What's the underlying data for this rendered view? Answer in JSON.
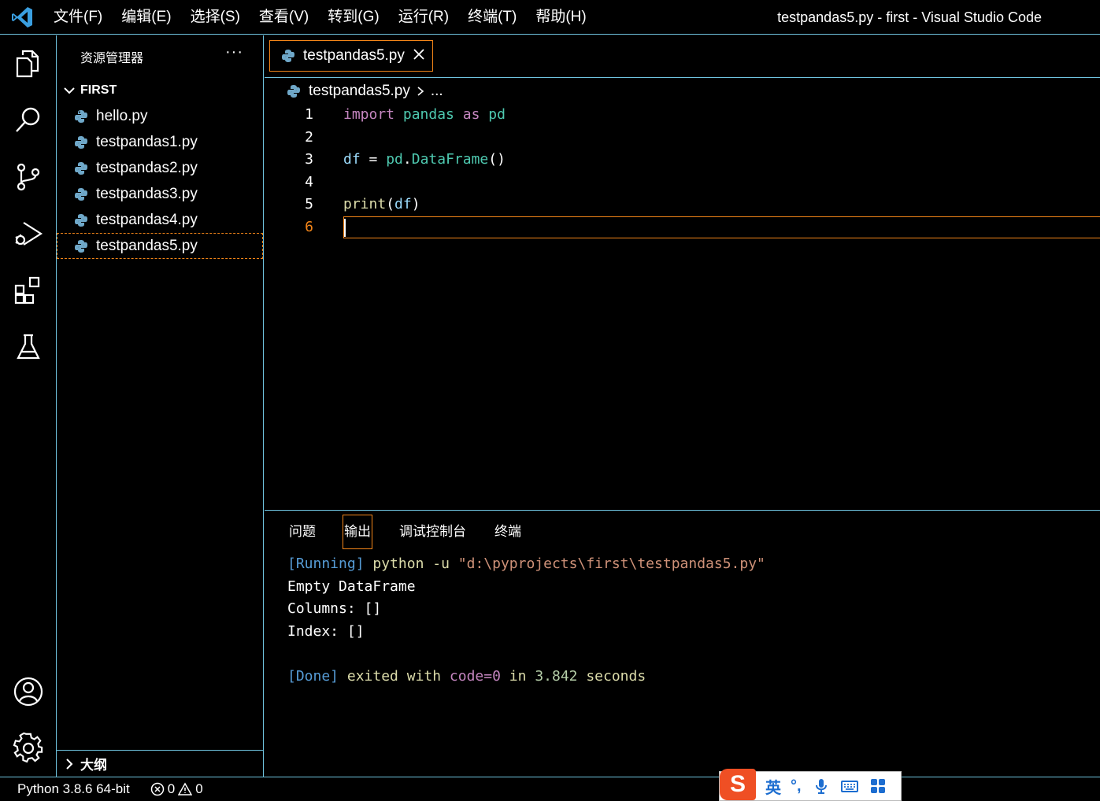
{
  "titlebar": {
    "menu": [
      "文件(F)",
      "编辑(E)",
      "选择(S)",
      "查看(V)",
      "转到(G)",
      "运行(R)",
      "终端(T)",
      "帮助(H)"
    ],
    "window_title": "testpandas5.py - first - Visual Studio Code"
  },
  "activity_bar": {
    "items": [
      "explorer-icon",
      "search-icon",
      "source-control-icon",
      "run-debug-icon",
      "extensions-icon",
      "testing-icon"
    ],
    "bottom": [
      "account-icon",
      "settings-gear-icon"
    ]
  },
  "sidebar": {
    "title": "资源管理器",
    "more": "···",
    "folder": "FIRST",
    "files": [
      "hello.py",
      "testpandas1.py",
      "testpandas2.py",
      "testpandas3.py",
      "testpandas4.py",
      "testpandas5.py"
    ],
    "active_file": "testpandas5.py",
    "outline": "大纲"
  },
  "editor": {
    "tab_label": "testpandas5.py",
    "breadcrumb_file": "testpandas5.py",
    "breadcrumb_more": "...",
    "line_numbers": [
      "1",
      "2",
      "3",
      "4",
      "5",
      "6"
    ],
    "current_line": 6,
    "code": {
      "line1": {
        "kw1": "import",
        "mod": "pandas",
        "kw2": "as",
        "alias": "pd"
      },
      "line3": {
        "var": "df",
        "eq": " = ",
        "obj": "pd",
        "dot": ".",
        "cls": "DataFrame",
        "args": "()"
      },
      "line5": {
        "fn": "print",
        "open": "(",
        "arg": "df",
        "close": ")"
      }
    }
  },
  "panel": {
    "tabs": [
      "问题",
      "输出",
      "调试控制台",
      "终端"
    ],
    "active_tab": "输出",
    "output": {
      "running_tag": "[Running]",
      "command_prefix": " python -u ",
      "command_path": "\"d:\\pyprojects\\first\\testpandas5.py\"",
      "line2": "Empty DataFrame",
      "line3": "Columns: []",
      "line4": "Index: []",
      "done_tag": "[Done]",
      "done_text1": " exited with ",
      "done_code": "code=0",
      "done_text2": " in ",
      "done_time": "3.842",
      "done_text3": " seconds"
    }
  },
  "statusbar": {
    "python": "Python 3.8.6 64-bit",
    "errors": "0",
    "warnings": "0"
  },
  "ime": {
    "logo": "S",
    "lang": "英",
    "punct": "°,"
  },
  "colors": {
    "border": "#6fc3df",
    "focus": "#f38518",
    "keyword": "#c586c0",
    "module": "#4ec9b0",
    "variable": "#9cdcfe",
    "function": "#dcdcaa"
  }
}
